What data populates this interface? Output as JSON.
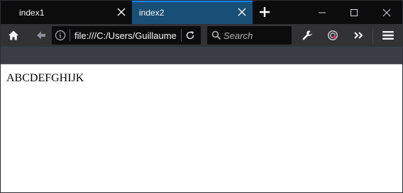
{
  "tabs": [
    {
      "label": "index1",
      "active": false
    },
    {
      "label": "index2",
      "active": true
    }
  ],
  "url_bar": {
    "value": "file:///C:/Users/Guillaume"
  },
  "search": {
    "placeholder": "Search"
  },
  "content": {
    "text": "ABCDEFGHIJK"
  },
  "icons": {
    "home": "home-icon",
    "back": "back-arrow-icon",
    "info": "info-icon",
    "reload": "reload-icon",
    "search": "search-icon",
    "wrench": "wrench-icon",
    "extension": "extension-icon",
    "overflow": "chevron-double-right-icon",
    "menu": "hamburger-menu-icon"
  },
  "colors": {
    "tab_strip": "#0c0c0d",
    "active_tab": "#1a4f75",
    "toolbar": "#323234",
    "field": "#0c0c0d",
    "text": "#f9f9fa"
  }
}
